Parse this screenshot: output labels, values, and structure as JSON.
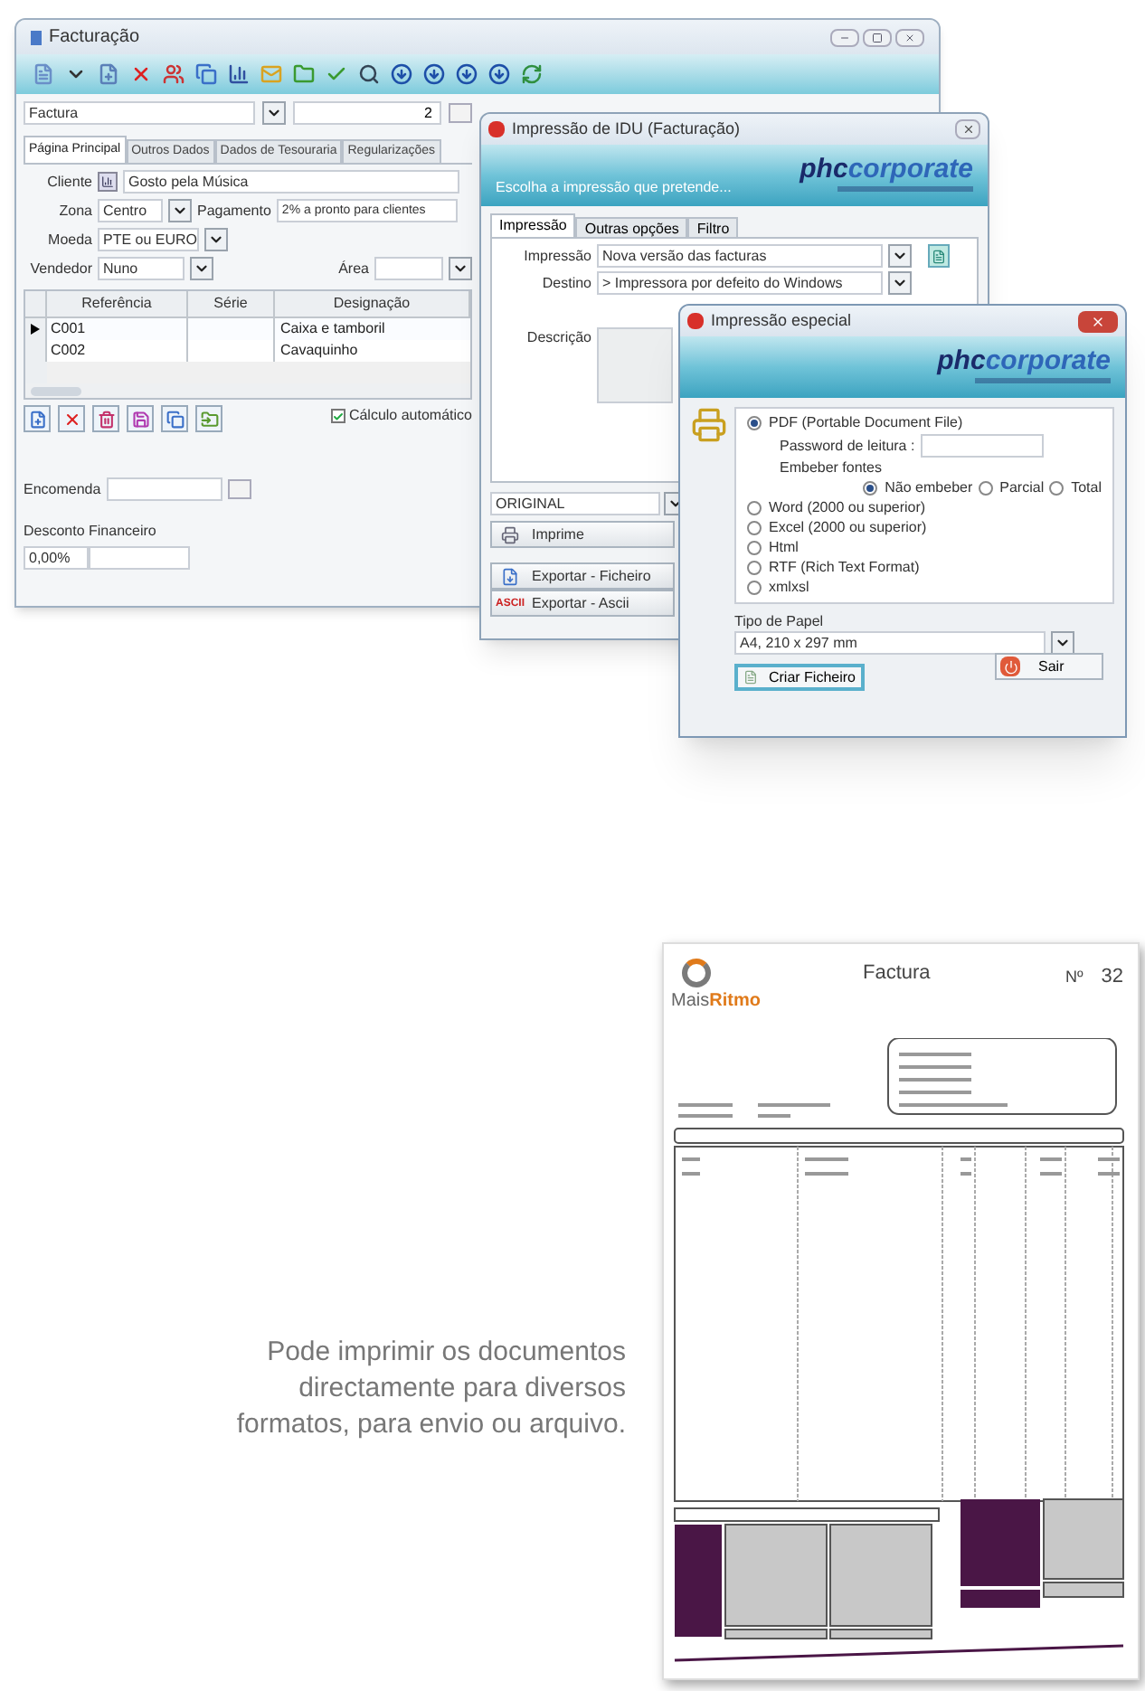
{
  "main_window": {
    "title": "Facturação",
    "document_type": "Factura",
    "number": "2",
    "tabs": [
      {
        "label": "Página Principal",
        "selected": true
      },
      {
        "label": "Outros Dados",
        "selected": false
      },
      {
        "label": "Dados de Tesouraria",
        "selected": false
      },
      {
        "label": "Regularizações",
        "selected": false
      }
    ],
    "cliente_label": "Cliente",
    "cliente": "Gosto pela Música",
    "zona_label": "Zona",
    "zona": "Centro",
    "pagamento_label": "Pagamento",
    "pagamento": "2% a pronto para clientes",
    "moeda_label": "Moeda",
    "moeda": "PTE ou EURO",
    "vendedor_label": "Vendedor",
    "vendedor": "Nuno",
    "area_label": "Área",
    "grid": {
      "columns": [
        "Referência",
        "Série",
        "Designação"
      ],
      "rows": [
        {
          "referencia": "C001",
          "designacao": "Caixa e tamboril",
          "selected": true
        },
        {
          "referencia": "C002",
          "designacao": "Cavaquinho",
          "selected": false
        }
      ]
    },
    "auto_calc": {
      "label": "Cálculo automático",
      "checked": true
    },
    "encomenda_label": "Encomenda",
    "desconto_label": "Desconto Financeiro",
    "desconto": "0,00%"
  },
  "print_window": {
    "title": "Impressão de IDU (Facturação)",
    "banner_text": "Escolha a impressão que pretende...",
    "logo_primary": "phc",
    "logo_secondary": "corporate",
    "tabs": [
      {
        "label": "Impressão",
        "selected": true
      },
      {
        "label": "Outras opções",
        "selected": false
      },
      {
        "label": "Filtro",
        "selected": false
      }
    ],
    "impressao_label": "Impressão",
    "impressao": "Nova versão das facturas",
    "destino_label": "Destino",
    "destino": "> Impressora por defeito do Windows",
    "descricao_label": "Descrição",
    "copy": "ORIGINAL",
    "buttons": [
      {
        "label": "Imprime",
        "kind": "print"
      },
      {
        "label": "Exportar - Ficheiro",
        "kind": "file"
      },
      {
        "label": "Exportar - Ascii",
        "kind": "ascii",
        "icon_text": "ASCII"
      }
    ]
  },
  "special_window": {
    "title": "Impressão especial",
    "logo_primary": "phc",
    "logo_secondary": "corporate",
    "formats": [
      {
        "label": "PDF (Portable Document File)",
        "selected": true
      },
      {
        "label": "Word (2000 ou superior)",
        "selected": false
      },
      {
        "label": "Excel (2000 ou superior)",
        "selected": false
      },
      {
        "label": "Html",
        "selected": false
      },
      {
        "label": "RTF (Rich Text Format)",
        "selected": false
      },
      {
        "label": "xmlxsl",
        "selected": false
      }
    ],
    "password_label": "Password de leitura :",
    "embed_label": "Embeber fontes",
    "embed_options": [
      {
        "label": "Não embeber",
        "selected": true
      },
      {
        "label": "Parcial",
        "selected": false
      },
      {
        "label": "Total",
        "selected": false
      }
    ],
    "paper_label": "Tipo de Papel",
    "paper": "A4, 210 x 297 mm",
    "create_button": "Criar Ficheiro",
    "exit_button": "Sair"
  },
  "document": {
    "brand_first": "Mais",
    "brand_second": "Ritmo",
    "title": "Factura",
    "number_label": "Nº",
    "number": "32"
  },
  "caption": "Pode imprimir os documentos directamente para diversos formatos, para envio ou arquivo."
}
